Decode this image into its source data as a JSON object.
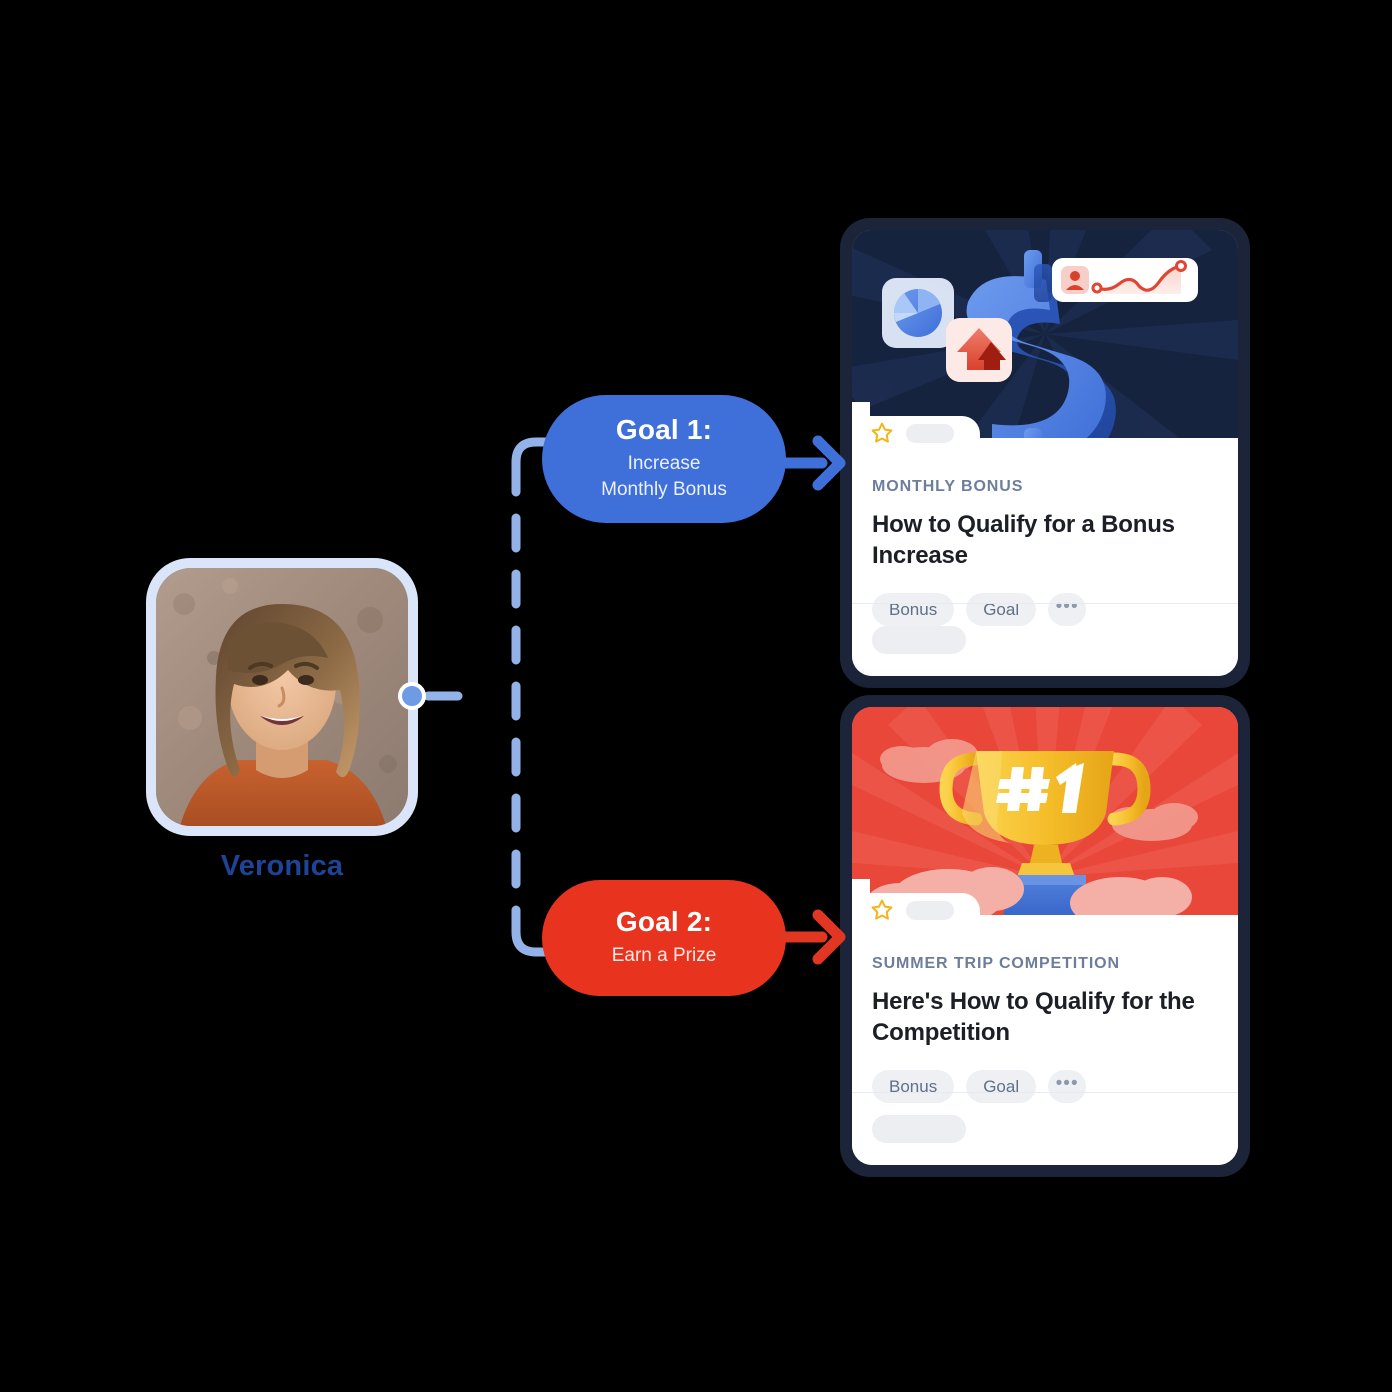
{
  "person": {
    "name": "Veronica",
    "avatar_icon": "user-photo",
    "node_dot": "connector-node"
  },
  "connector": {
    "style": "dashed",
    "color": "#93b2e8",
    "arrow_top_color": "#5b8ae0",
    "arrow_bottom_color": "#5b8ae0"
  },
  "goals": [
    {
      "title": "Goal 1:",
      "subtitle": "Increase\nMonthly Bonus",
      "subtitle_line1": "Increase",
      "subtitle_line2": "Monthly Bonus",
      "color": "#3f6fd8",
      "arrow_color": "#3f6fd8"
    },
    {
      "title": "Goal 2:",
      "subtitle": "Earn a Prize",
      "subtitle_line1": "Earn a Prize",
      "subtitle_line2": "",
      "color": "#e8341f",
      "arrow_color": "#e13622"
    }
  ],
  "cards": [
    {
      "hero_illustration": "dollar-sign-3d",
      "hero_bg": "#16233f",
      "star_icon": "star-outline-icon",
      "eyebrow": "MONTHLY BONUS",
      "title": "How to Qualify for a Bonus Increase",
      "chips": [
        "Bonus",
        "Goal"
      ],
      "more_label": "•••"
    },
    {
      "hero_illustration": "trophy-number-one",
      "hero_bg": "#e8473a",
      "trophy_label": "#1",
      "star_icon": "star-outline-icon",
      "eyebrow": "SUMMER TRIP COMPETITION",
      "title": "Here's How to Qualify for the Competition",
      "chips": [
        "Bonus",
        "Goal"
      ],
      "more_label": "•••"
    }
  ],
  "colors": {
    "background": "#000000",
    "name_text": "#1f4397",
    "card_frame": "#1b2438",
    "eyebrow_text": "#6d7e9c",
    "chip_bg": "#eef0f3",
    "star": "#f5b518"
  }
}
